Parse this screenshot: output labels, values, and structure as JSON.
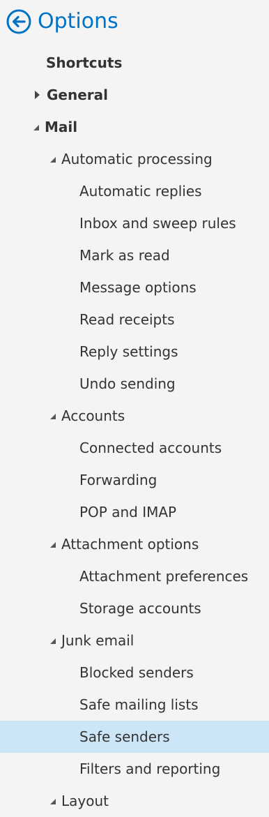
{
  "header": {
    "title": "Options",
    "back_icon": "back-arrow-circle-icon",
    "accent_color": "#0072c6"
  },
  "nav": {
    "shortcuts": "Shortcuts",
    "general": "General",
    "mail": "Mail",
    "automatic_processing": {
      "label": "Automatic processing",
      "items": [
        "Automatic replies",
        "Inbox and sweep rules",
        "Mark as read",
        "Message options",
        "Read receipts",
        "Reply settings",
        "Undo sending"
      ]
    },
    "accounts": {
      "label": "Accounts",
      "items": [
        "Connected accounts",
        "Forwarding",
        "POP and IMAP"
      ]
    },
    "attachment_options": {
      "label": "Attachment options",
      "items": [
        "Attachment preferences",
        "Storage accounts"
      ]
    },
    "junk_email": {
      "label": "Junk email",
      "items": [
        "Blocked senders",
        "Safe mailing lists",
        "Safe senders",
        "Filters and reporting"
      ]
    },
    "layout": {
      "label": "Layout"
    },
    "selected_item": "Safe senders",
    "selected_color": "#cde6f7"
  }
}
